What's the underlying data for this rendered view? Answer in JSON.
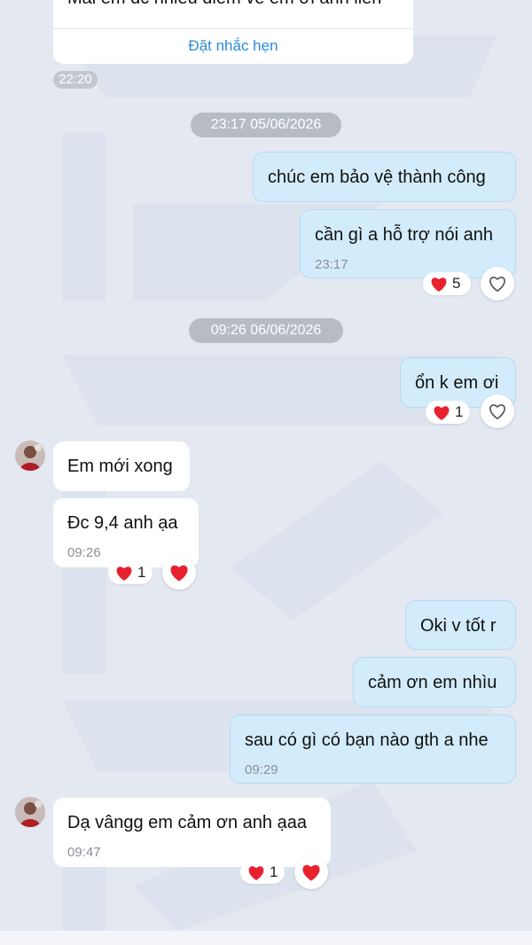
{
  "card": {
    "partial_text": "Mai em dc nhiều điểm về em ơi anh liền",
    "action_label": "Đặt nhắc hẹn",
    "time": "22:20"
  },
  "separators": [
    "23:17 05/06/2026",
    "09:26 06/06/2026"
  ],
  "messages": [
    {
      "side": "out",
      "text": "chúc em bảo vệ thành công"
    },
    {
      "side": "out",
      "text": "cần gì a hỗ trợ nói anh",
      "time": "23:17",
      "reaction_count": "5"
    },
    {
      "side": "out",
      "text": "ổn k em ơi",
      "reaction_count": "1"
    },
    {
      "side": "in",
      "text": "Em mới xong"
    },
    {
      "side": "in",
      "text": "Đc 9,4 anh ạa",
      "time": "09:26",
      "reaction_count": "1"
    },
    {
      "side": "out",
      "text": "Oki v tốt r"
    },
    {
      "side": "out",
      "text": "cảm ơn em nhìu"
    },
    {
      "side": "out",
      "text": "sau có gì có bạn nào gth a nhe",
      "time": "09:29"
    },
    {
      "side": "in",
      "text": "Dạ vângg em cảm ơn anh ạaa",
      "time": "09:47",
      "reaction_count": "1"
    }
  ],
  "icons": {
    "reaction": "heart-icon",
    "react_button": "heart-outline-icon",
    "my_reaction": "heart-filled-icon"
  },
  "colors": {
    "background": "#e4e8f1",
    "incoming_bubble": "#ffffff",
    "outgoing_bubble": "#d3ecfb",
    "link": "#2a8bd8",
    "heart": "#e8212f"
  }
}
